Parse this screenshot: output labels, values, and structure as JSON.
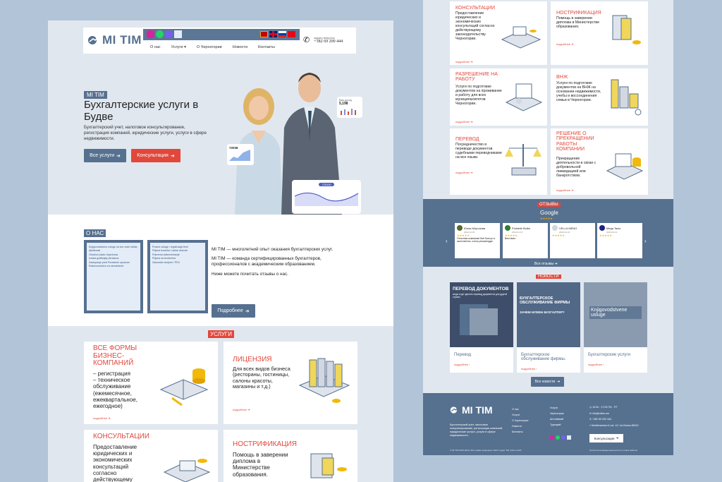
{
  "left": {
    "header": {
      "logo": "MI TIM",
      "nav": [
        "О нас",
        "Услуги",
        "О Черногории",
        "Новости",
        "Контакты"
      ],
      "contact_label": "задать вопросы",
      "phone": "+382 69 200 444",
      "flags": [
        "me",
        "gb",
        "ru",
        "tr"
      ]
    },
    "hero": {
      "badge": "MI TIM",
      "title": "Бухгалтерские услуги в Будве",
      "subtitle": "Бухгалтерский учет, налоговое консультирование, регистрация компаний, юридические услуги, услуги в сфере недвижимости.",
      "btn_services": "Все услуги",
      "btn_consult": "Консультация",
      "chip1_label": "Ваш доход",
      "chip1_value": "5,198",
      "chip2_value": "72036",
      "chip3_value": "725100"
    },
    "about": {
      "label": "О НАС",
      "p1": "MI TIM — многолетний опыт оказания бухгалтерских услуг.",
      "p2": "MI TIM — команда сертифицированных бухгалтеров, профессионалов с академическим образованием.",
      "p3": "Ниже можете почитать отзывы о нас.",
      "btn": "Подробнее",
      "doc1_items": [
        "Knjigovodstvene usluge za sve vrste oblika djelatnosti",
        "Obračun plata i doprinosa",
        "Izrada godišnjeg obračuna",
        "Zastupanje pred Poreskom upravom",
        "Računovodstvo za nerezidente"
      ],
      "doc2_items": [
        "Pravne usluge i registracija firmi",
        "Prijava boravka i radne dozvole",
        "Priprema dokumentacije",
        "Prijava na tenderima",
        "Zakonske izmjene i PDV"
      ]
    },
    "services": {
      "label": "УСЛУГИ",
      "more": "подробнее",
      "cards": [
        {
          "title": "ВСЕ ФОРМЫ БИЗНЕС-КОМПАНИЙ",
          "desc": "– регистрация\n– техническое обслуживание (ежемесячное, ежеквартальное, ежегодное)"
        },
        {
          "title": "ЛИЦЕНЗИЯ",
          "desc": "Для всех видов бизнеса (рестораны, гостиницы, салоны красоты, магазины и т.д.)"
        },
        {
          "title": "КОНСУЛЬТАЦИИ",
          "desc": "Предоставление юридических и экономических консультаций согласно действующему"
        },
        {
          "title": "НОСТРИФИКАЦИЯ",
          "desc": "Помощь в заверении диплома в Министерстве образования."
        }
      ]
    }
  },
  "right": {
    "cards": [
      {
        "title": "КОНСУЛЬТАЦИИ",
        "desc": "Предоставление юридических и экономических консультаций согласно действующему законодательству Черногории."
      },
      {
        "title": "НОСТРИФИКАЦИЯ",
        "desc": "Помощь в заверении диплома в Министерстве образования."
      },
      {
        "title": "РАЗРЕШЕНИЕ НА РАБОТУ",
        "desc": "Услуги по подготовке документов на проживание и работу для всех муниципалитетов Черногории."
      },
      {
        "title": "ВНЖ",
        "desc": "Услуги по подготовке документов на ВНЖ на основании недвижимости, учебы и воссоединения семьи в Черногории."
      },
      {
        "title": "ПЕРЕВОД",
        "desc": "Посредничество в переводе документов судебными переводчиками на все языки."
      },
      {
        "title": "РЕШЕНИЕ О ПРЕКРАЩЕНИИ РАБОТЫ КОМПАНИИ",
        "desc": "Прекращение деятельности в связи с добровольной ликвидацией или банкротством."
      }
    ],
    "more": "подробнее",
    "reviews": {
      "label": "ОТЗЫВЫ",
      "source": "Google",
      "all": "Все отзывы",
      "items": [
        {
          "name": "Юлия Морозова",
          "date": "2022-12-06",
          "text": "Отличная компания! Всё быстро и качественно, очень рекомендую",
          "avatar": "#556b2f"
        },
        {
          "name": "Portable Bulbs",
          "date": "2023-01-15",
          "text": "Best team",
          "avatar": "#2e7d32"
        },
        {
          "name": "VELLA MENG",
          "date": "2023-02-01",
          "text": "",
          "avatar": "#cfd8dc"
        },
        {
          "name": "Mega Taxio",
          "date": "2023-03-12",
          "text": "",
          "avatar": "#1a237e"
        }
      ]
    },
    "news": {
      "label": "НОВОСТИ",
      "all": "Все новости",
      "more": "подробнее",
      "items": [
        {
          "img_title": "ПЕРЕВОД ДОКУМЕНТОВ",
          "img_sub": "когда и где сделать перевод документов для другой страны",
          "title": "Перевод",
          "img_bg": "#3e4e6a"
        },
        {
          "img_title": "БУХГАЛТЕРСКОЕ ОБСЛУЖИВАНИЕ ФИРМЫ",
          "img_sub": "ЗАЧЕМ НУЖЕН БУХГАЛТЕР?",
          "title": "Бухгалтерское обслуживание фирмы.",
          "img_bg": "#516887"
        },
        {
          "img_title": "Knjigovodstvene usluge",
          "img_sub": "",
          "title": "Бухгалтерские услуги",
          "img_bg": "#8a9bb0"
        }
      ]
    },
    "footer": {
      "logo": "MI TIM",
      "desc": "Бухгалтерский учет, налоговое консультирование, регистрация компаний, юридические услуги, услуги в сфере недвижимости.",
      "col1": [
        "О нас",
        "Услуги",
        "О Черногории",
        "Новости",
        "Контакты"
      ],
      "col2": [
        "Услуги",
        "Черногория",
        "Английский",
        "Турецкий"
      ],
      "contacts": [
        "10:00 - 17:00 ПН - ПТ",
        "info@mitim.me",
        "+382 69 200 444",
        "Mediteranska 6 Lok. 12 / 4a Budva 85310"
      ],
      "btn": "Консультация",
      "copyright": "© MI TIM 2019-2023 | Все права защищены | Веб студия \"Mir online world\"",
      "privacy": "Политика конфиденциальности и cookie файлов"
    }
  },
  "colors": {
    "accent": "#e2473b",
    "brand": "#56708f",
    "bg": "#b2c4d8"
  }
}
